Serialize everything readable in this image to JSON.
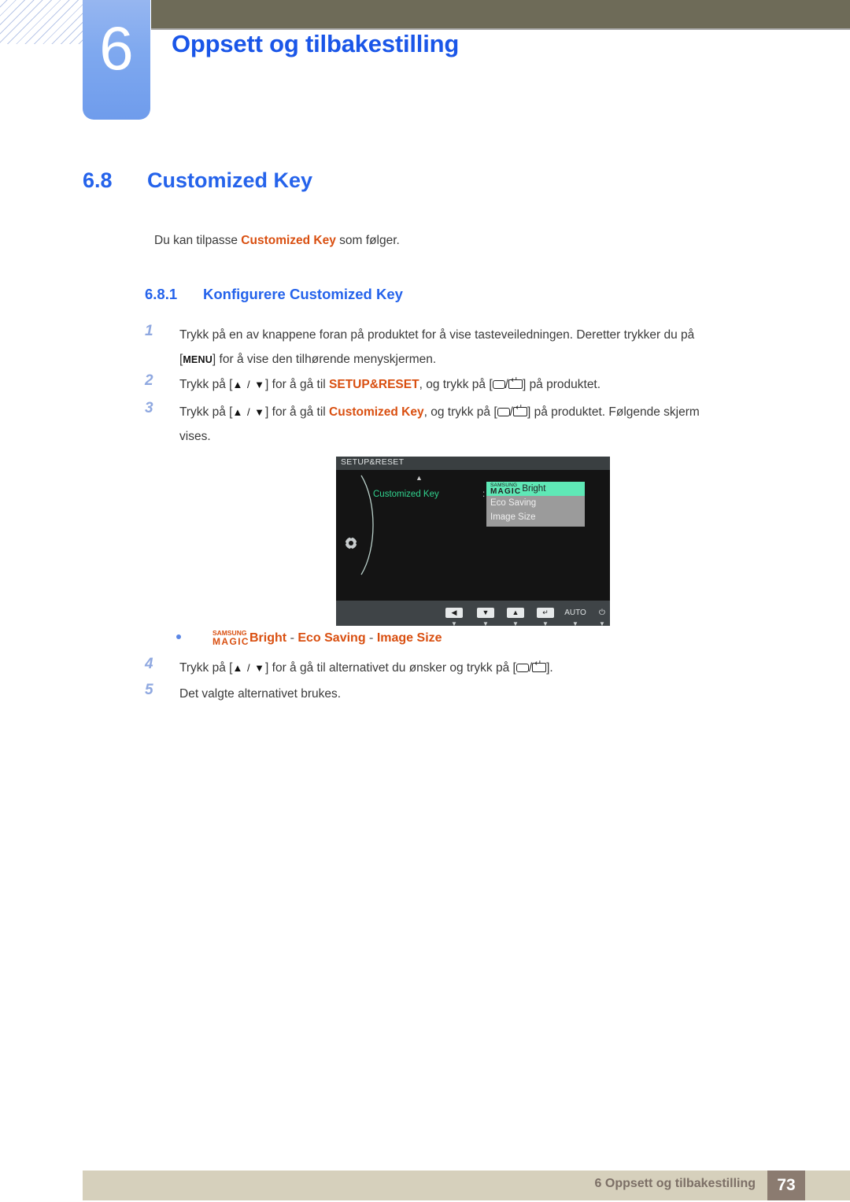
{
  "header": {
    "chapter_number": "6",
    "chapter_title": "Oppsett og tilbakestilling",
    "accent_color": "#1a56e8",
    "tab_color": "#7ea8ef",
    "bar_color": "#6e6b58"
  },
  "section": {
    "number": "6.8",
    "title": "Customized Key",
    "intro_before": "Du kan tilpasse ",
    "intro_emph": "Customized Key",
    "intro_after": " som følger."
  },
  "subsection": {
    "number": "6.8.1",
    "title": "Konfigurere Customized Key"
  },
  "steps": [
    {
      "num": "1",
      "part1": "Trykk på en av knappene foran på produktet for å vise tasteveiledningen. Deretter trykker du på",
      "key": "MENU",
      "part2": "for å vise den tilhørende menyskjermen."
    },
    {
      "num": "2",
      "part1": "Trykk på [",
      "arrows": "▲ / ▼",
      "part2": "] for å gå til ",
      "emph": "SETUP&RESET",
      "part3": ", og trykk på [",
      "part4": "] på produktet."
    },
    {
      "num": "3",
      "part1": "Trykk på [",
      "arrows": "▲ / ▼",
      "part2": "] for å gå til ",
      "emph": "Customized Key",
      "part3": ", og trykk på [",
      "part4": "] på produktet. Følgende skjerm",
      "part5": "vises."
    },
    {
      "num": "4",
      "part1": "Trykk på [",
      "arrows": "▲ / ▼",
      "part2": "] for å gå til alternativet du ønsker og trykk på [",
      "part3": "]."
    },
    {
      "num": "5",
      "part1": "Det valgte alternativet brukes."
    }
  ],
  "bullet": {
    "magic_top": "SAMSUNG",
    "magic_bottom": "MAGIC",
    "item1": "Bright",
    "sep1": "-",
    "item2": "Eco Saving",
    "sep2": "-",
    "item3": "Image Size",
    "color": "#d94f10"
  },
  "osd": {
    "title": "SETUP&RESET",
    "menu_label": "Customized Key",
    "menu_label_color": "#31d38f",
    "colon": ":",
    "options": [
      {
        "magic_top": "SAMSUNG",
        "magic_bottom": "MAGIC",
        "label": "Bright",
        "selected": true
      },
      {
        "label": "Eco Saving",
        "selected": false
      },
      {
        "label": "Image Size",
        "selected": false
      }
    ],
    "highlight_color": "#5fe8b6",
    "dropdown_bg": "#9b9b9b",
    "buttons": [
      {
        "glyph": "◀",
        "type": "cap",
        "tick": "▼"
      },
      {
        "glyph": "▼",
        "type": "cap",
        "tick": "▼"
      },
      {
        "glyph": "▲",
        "type": "cap",
        "tick": "▼"
      },
      {
        "glyph": "↵",
        "type": "cap",
        "tick": "▼"
      },
      {
        "glyph": "AUTO",
        "type": "text",
        "tick": "▼"
      },
      {
        "glyph": "⏻",
        "type": "text",
        "tick": "▼"
      }
    ]
  },
  "footer": {
    "text": "6 Oppsett og tilbakestilling",
    "page": "73",
    "bar_color": "#d6d0bc",
    "page_box_color": "#8b7b70"
  }
}
